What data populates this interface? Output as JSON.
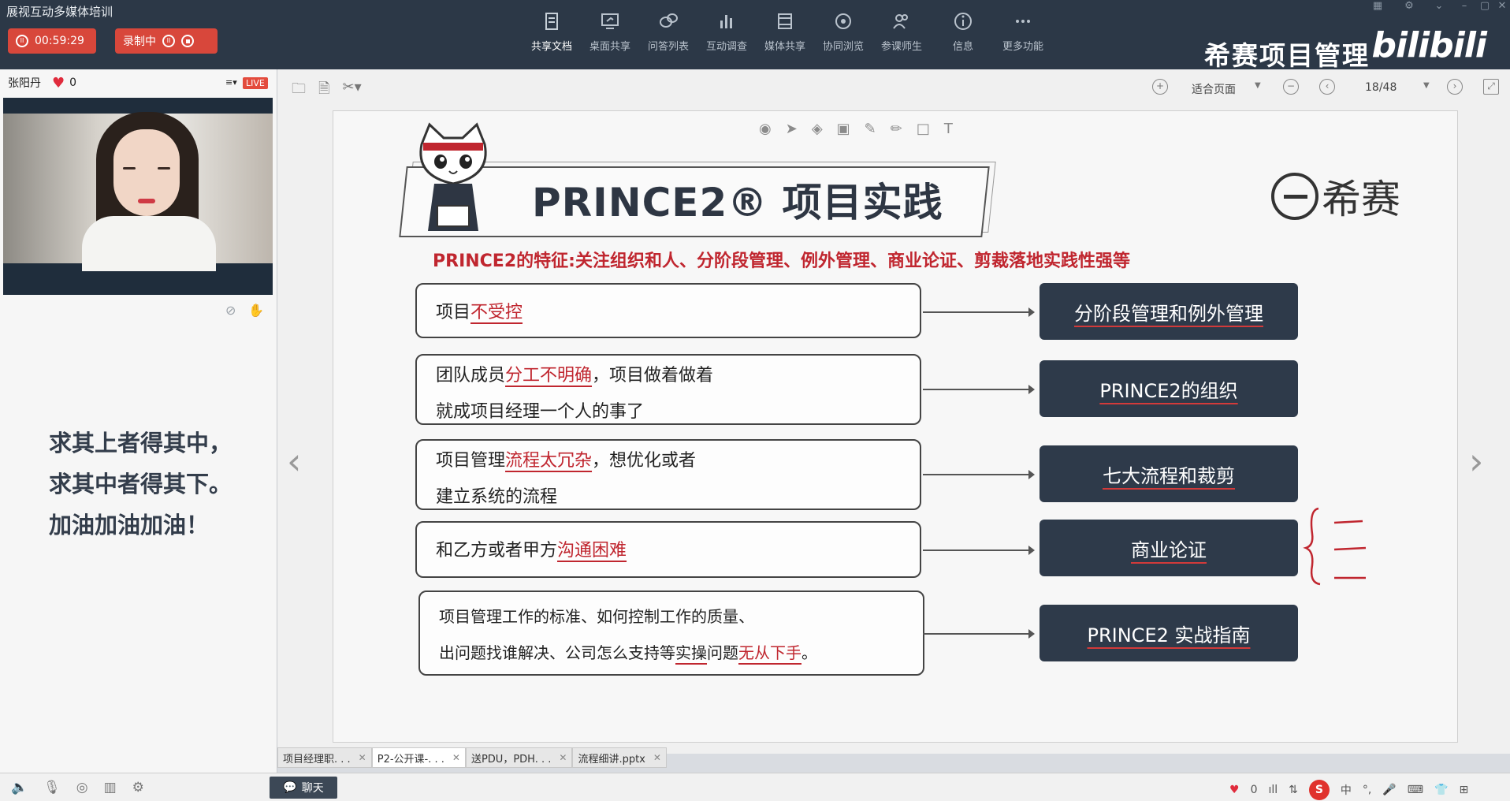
{
  "app": {
    "title": "展视互动多媒体培训"
  },
  "session": {
    "timer": "00:59:29",
    "record_label": "录制中"
  },
  "toolbar": {
    "items": [
      {
        "label": "共享文档",
        "icon": "document-share-icon"
      },
      {
        "label": "桌面共享",
        "icon": "desktop-share-icon"
      },
      {
        "label": "问答列表",
        "icon": "qa-list-icon"
      },
      {
        "label": "互动调查",
        "icon": "survey-chart-icon"
      },
      {
        "label": "媒体共享",
        "icon": "media-share-icon"
      },
      {
        "label": "协同浏览",
        "icon": "cobrowse-icon"
      },
      {
        "label": "参课师生",
        "icon": "participants-icon"
      },
      {
        "label": "信息",
        "icon": "info-icon"
      },
      {
        "label": "更多功能",
        "icon": "more-icon"
      }
    ],
    "brand": "希赛项目管理",
    "bili": "bilibili"
  },
  "presenter": {
    "name": "张阳丹",
    "likes": "0",
    "live": "LIVE"
  },
  "motto": {
    "line1": "求其上者得其中，",
    "line2": "求其中者得其下。",
    "line3": "加油加油加油！"
  },
  "viewer": {
    "fit": "适合页面",
    "page": "18/48"
  },
  "slide": {
    "title": "PRINCE2® 项目实践",
    "logo": "希赛",
    "subtitle": "PRINCE2的特征:关注组织和人、分阶段管理、例外管理、商业论证、剪裁落地实践性强等",
    "problems": [
      {
        "a": "项目",
        "b": "不受控"
      },
      {
        "a": "团队成员",
        "b": "分工不明确",
        "c": "，项目做着做着",
        "d": "就成项目经理一个人的事了"
      },
      {
        "a": "项目管理",
        "b": "流程太冗杂",
        "c": "，想优化或者",
        "d": "建立系统的流程"
      },
      {
        "a": "和乙方或者甲方",
        "b": "沟通困难"
      },
      {
        "line1": "项目管理工作的标准、如何控制工作的质量、",
        "a": "出问题找谁解决、公司怎么支持等",
        "b": "实操",
        "c": "问题",
        "d": "无从下手",
        "e": "。"
      }
    ],
    "solutions": [
      "分阶段管理和例外管理",
      "PRINCE2的组织",
      "七大流程和裁剪",
      "商业论证",
      "PRINCE2 实战指南"
    ]
  },
  "tabs": [
    {
      "label": "项目经理职. . ."
    },
    {
      "label": "P2-公开课-. . ."
    },
    {
      "label": "送PDU，PDH. . ."
    },
    {
      "label": "流程细讲.pptx"
    }
  ],
  "status": {
    "chat": "聊天",
    "likes": "0",
    "ime": "中"
  },
  "colors": {
    "topbar": "#2c3847",
    "record_red": "#d8473b",
    "accent_red": "#c0262f",
    "solution_box": "#2e3a4a"
  }
}
